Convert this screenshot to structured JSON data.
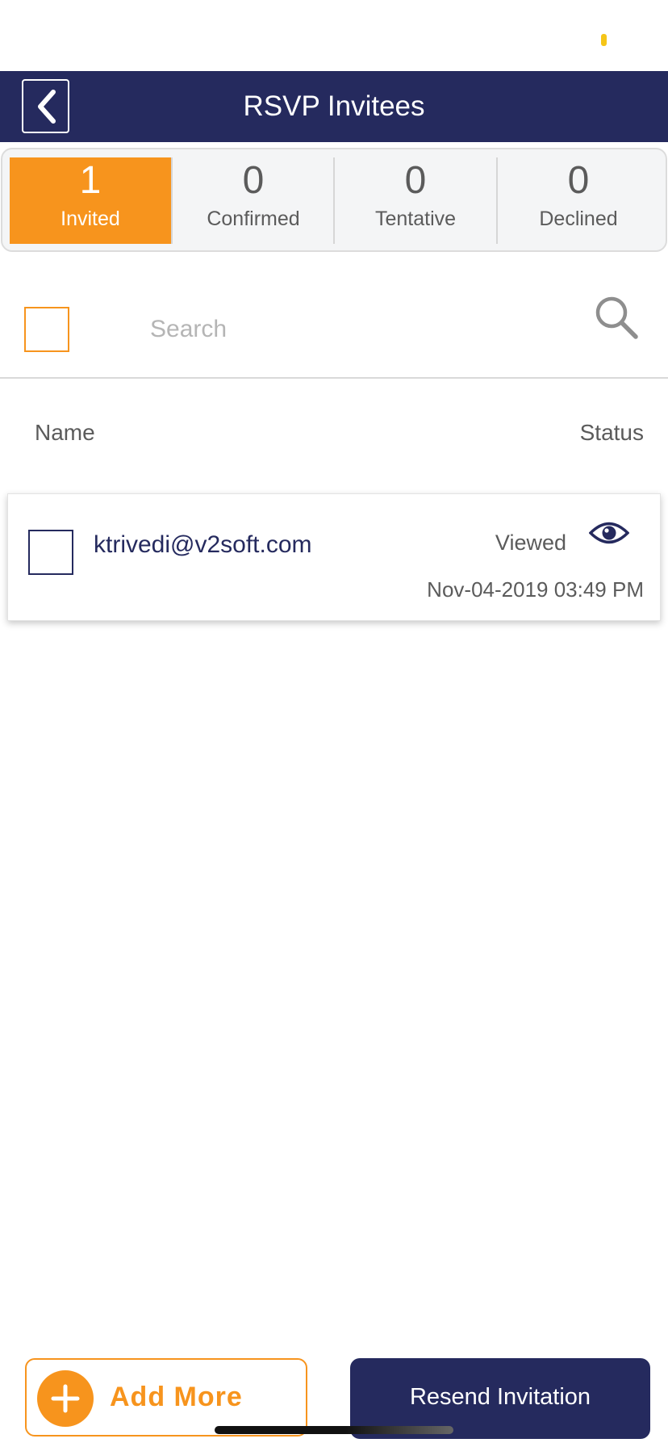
{
  "header": {
    "title": "RSVP Invitees"
  },
  "tabs": [
    {
      "count": "1",
      "label": "Invited",
      "active": true
    },
    {
      "count": "0",
      "label": "Confirmed",
      "active": false
    },
    {
      "count": "0",
      "label": "Tentative",
      "active": false
    },
    {
      "count": "0",
      "label": "Declined",
      "active": false
    }
  ],
  "search": {
    "placeholder": "Search",
    "value": ""
  },
  "columns": {
    "name": "Name",
    "status": "Status"
  },
  "invitees": [
    {
      "email": "ktrivedi@v2soft.com",
      "status": "Viewed",
      "status_icon": "eye-icon",
      "date": "Nov-04-2019 03:49 PM"
    }
  ],
  "footer": {
    "add_more_label": "Add More",
    "resend_label": "Resend Invitation"
  },
  "colors": {
    "navy": "#252a5e",
    "orange": "#f7941d",
    "status_dot": "#f5c518"
  },
  "icons": {
    "back": "chevron-left-icon",
    "search": "search-icon",
    "add": "plus-icon",
    "status": "eye-icon"
  }
}
